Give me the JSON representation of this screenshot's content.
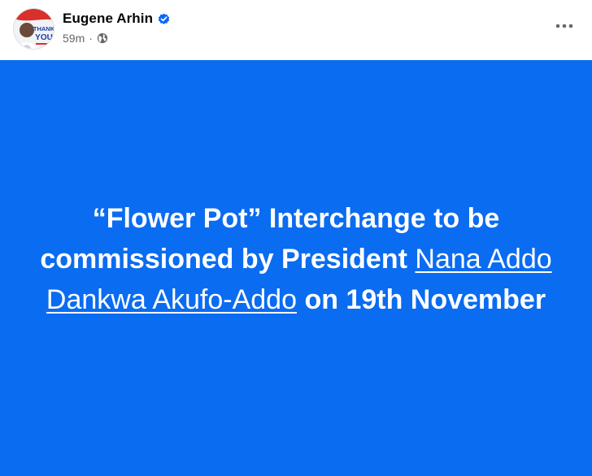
{
  "author": {
    "name": "Eugene Arhin",
    "verified": true,
    "avatar_text": [
      "THANK",
      "YOU"
    ]
  },
  "post": {
    "timestamp": "59m",
    "separator": "·",
    "privacy_icon": "globe-icon",
    "more_icon": "more-horizontal-icon",
    "text_before": "“Flower Pot” Interchange to be commissioned by President",
    "link_text": "Nana Addo Dankwa Akufo-Addo",
    "text_after": "on 19th November",
    "background_color": "#0a6cf0",
    "text_color": "#ffffff"
  }
}
